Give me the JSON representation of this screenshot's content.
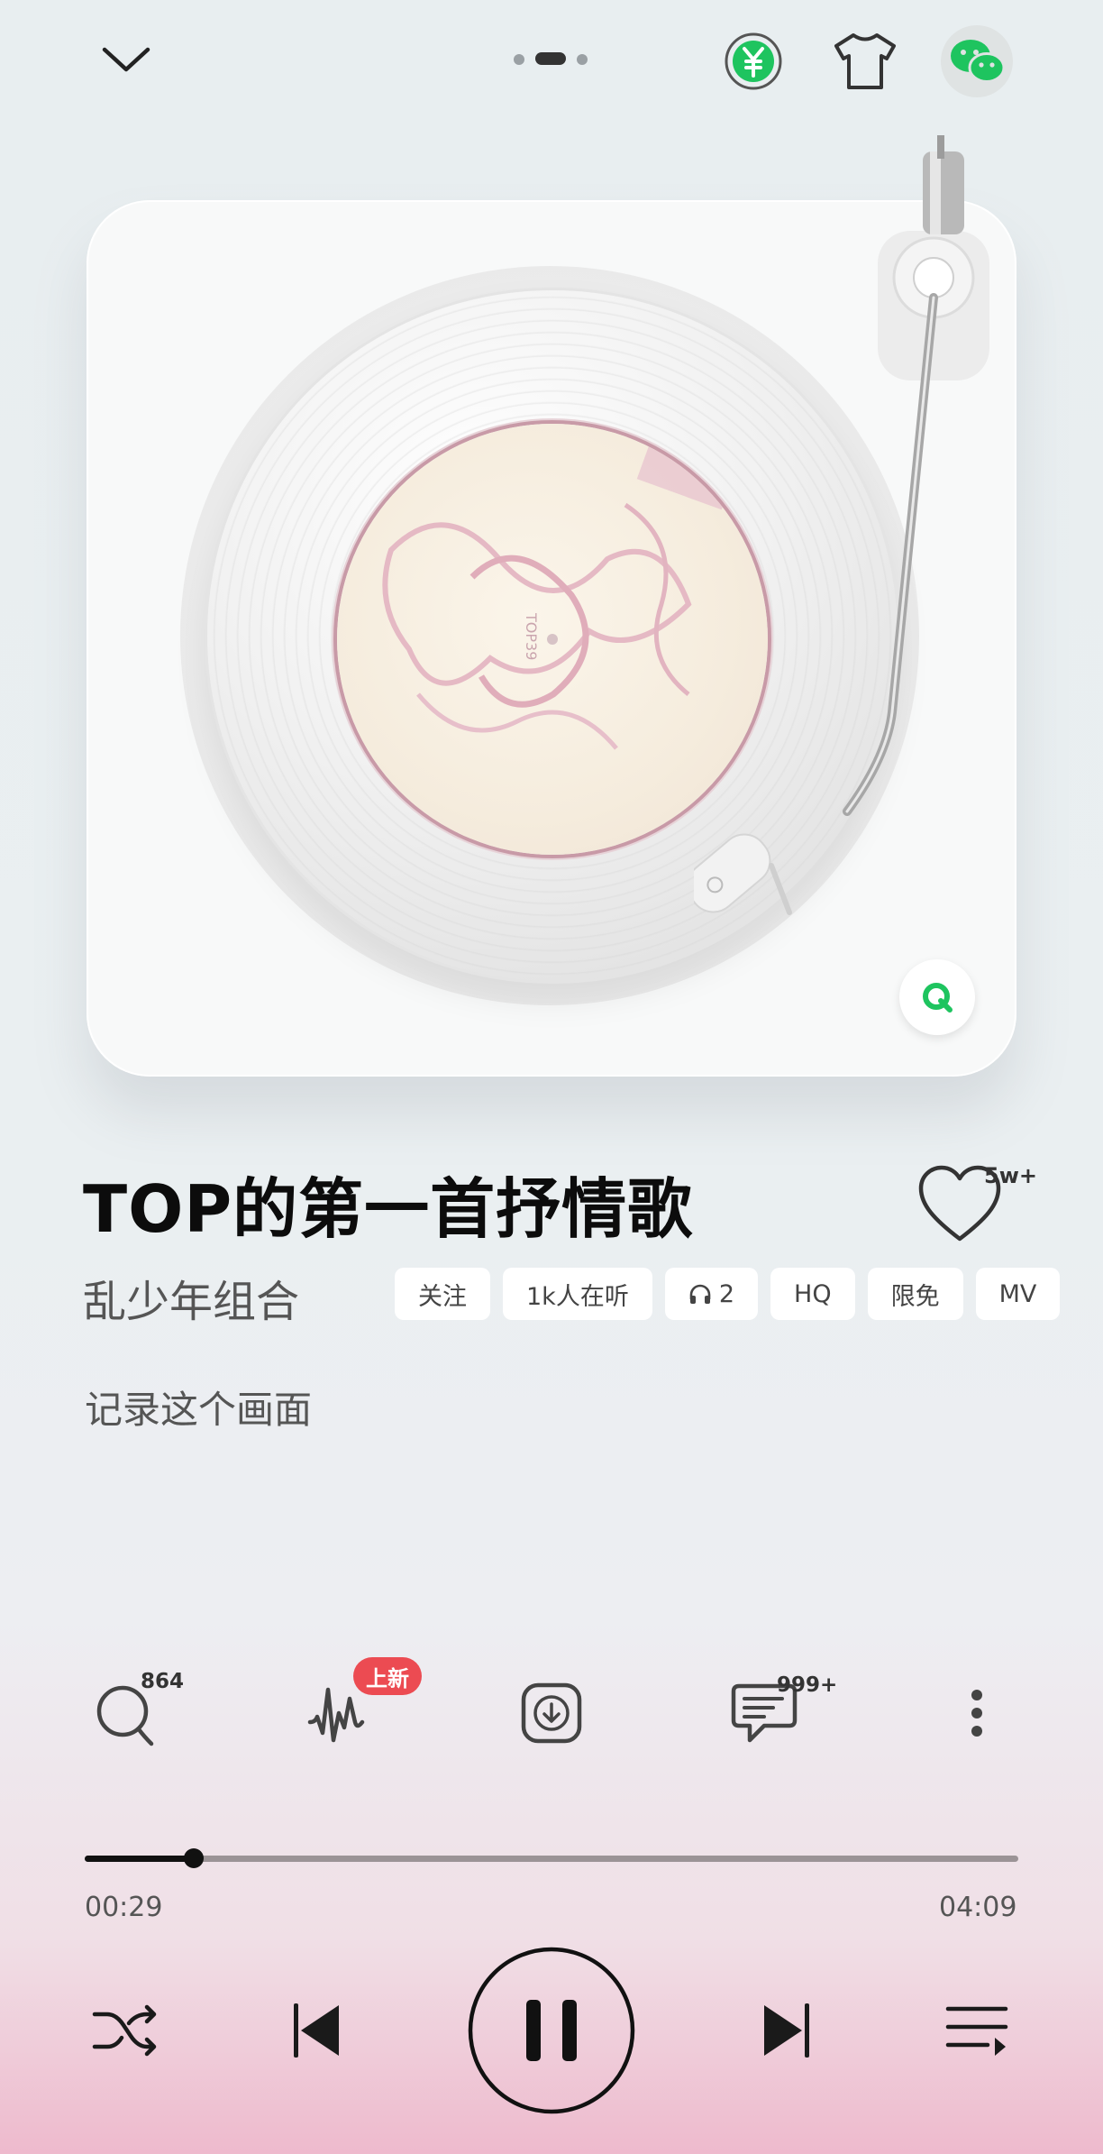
{
  "header": {
    "collapse_icon": "chevron-down-icon",
    "page_dots": 3,
    "active_page_dot": 1,
    "icons": [
      "yuan-coin-icon",
      "tshirt-skin-icon",
      "wechat-share-icon"
    ]
  },
  "player": {
    "brand_badge_icon": "qq-music-icon"
  },
  "song": {
    "title": "TOP的第一首抒情歌",
    "artist": "乱少年组合",
    "favorite_count": "5w+",
    "tags": [
      "关注",
      "1k人在听",
      "2",
      "HQ",
      "限免",
      "MV"
    ],
    "lyric_line": "记录这个画面"
  },
  "actions": {
    "search_count": "864",
    "effects_badge": "上新",
    "comment_count": "999+",
    "items": [
      "search-icon",
      "sound-effect-icon",
      "download-icon",
      "comment-icon",
      "more-icon"
    ]
  },
  "progress": {
    "current": "00:29",
    "total": "04:09",
    "fraction": 0.117
  },
  "controls": [
    "shuffle-icon",
    "previous-icon",
    "pause-icon",
    "next-icon",
    "playlist-icon"
  ],
  "colors": {
    "accent_green": "#1ec45f",
    "badge_red": "#ec4b52",
    "bg_pink": "#eebacd"
  }
}
